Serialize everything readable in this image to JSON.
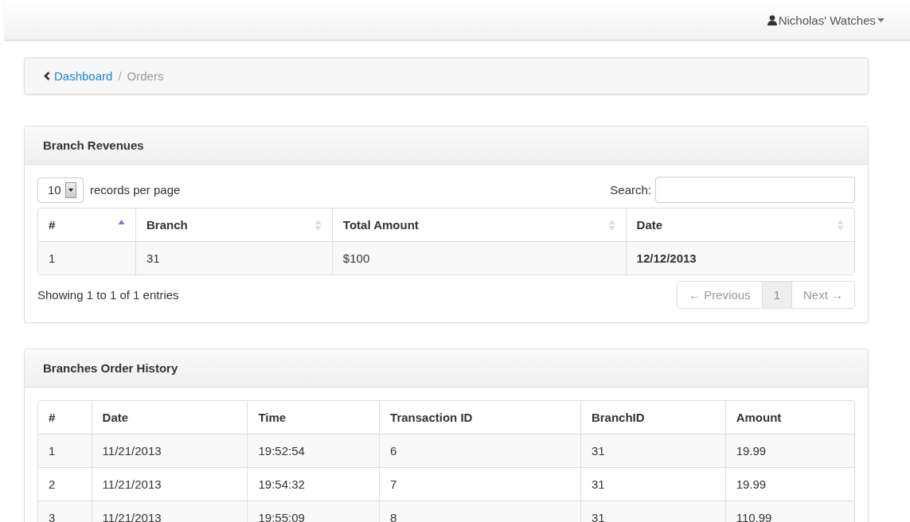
{
  "navbar": {
    "user_menu": "Nicholas' Watches"
  },
  "breadcrumb": [
    {
      "label": "Dashboard",
      "kind": "link"
    },
    {
      "label": "/",
      "kind": "separator"
    },
    {
      "label": "Orders",
      "kind": "current"
    }
  ],
  "revenues_panel": {
    "title": "Branch Revenues",
    "page_size": "10",
    "page_size_label": "records per page",
    "search_label": "Search:",
    "columns": [
      {
        "label": "#",
        "sorted": true
      },
      {
        "label": "Branch",
        "sorted": false
      },
      {
        "label": "Total Amount",
        "sorted": false
      },
      {
        "label": "Date",
        "sorted": false
      }
    ],
    "rows": [
      [
        "1",
        "31",
        "$100",
        "12/12/2013"
      ]
    ],
    "info": "Showing 1 to 1 of 1 entries",
    "pagination": [
      {
        "label": "← Previous",
        "disabled": true,
        "selected": false
      },
      {
        "label": "1",
        "disabled": false,
        "selected": true
      },
      {
        "label": "Next →",
        "disabled": true,
        "selected": false
      }
    ]
  },
  "history_panel": {
    "title": "Branches Order History",
    "columns": [
      "#",
      "Date",
      "Time",
      "Transaction ID",
      "BranchID",
      "Amount"
    ],
    "rows": [
      [
        "1",
        "11/21/2013",
        "19:52:54",
        "6",
        "31",
        "19.99"
      ],
      [
        "2",
        "11/21/2013",
        "19:54:32",
        "7",
        "31",
        "19.99"
      ],
      [
        "3",
        "11/21/2013",
        "19:55:09",
        "8",
        "31",
        "110.99"
      ]
    ]
  }
}
